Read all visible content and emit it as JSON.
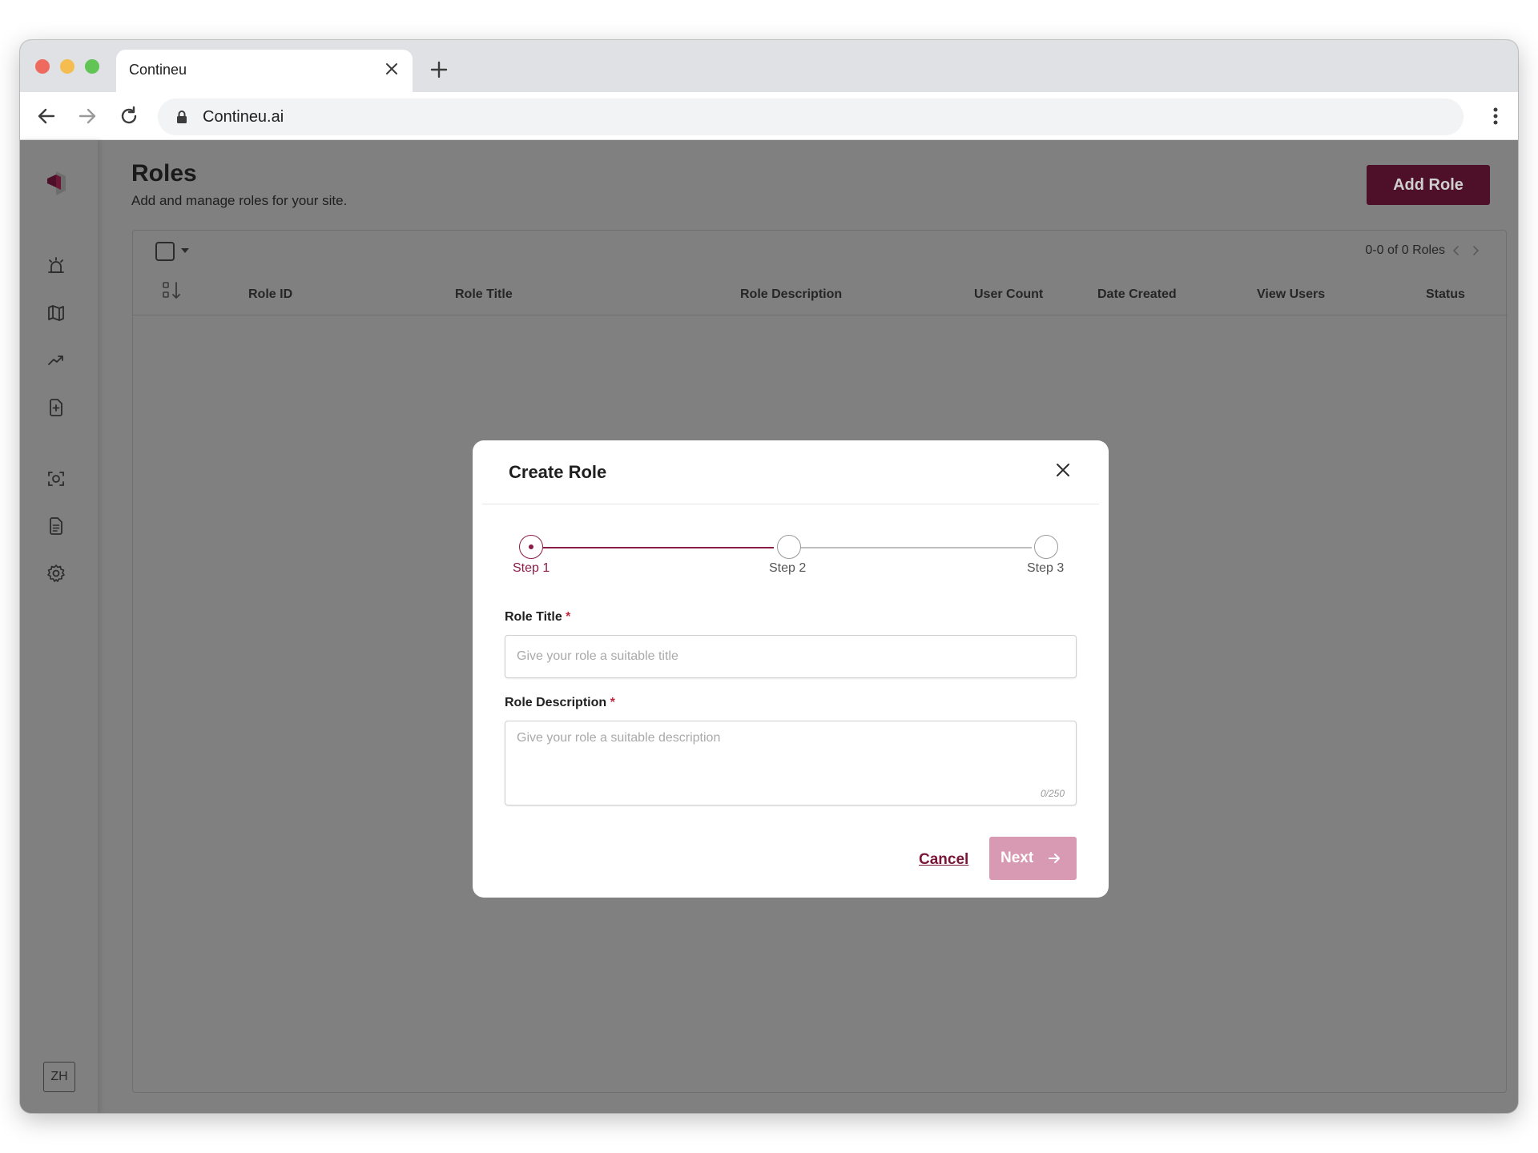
{
  "browser": {
    "tab_title": "Contineu",
    "url": "Contineu.ai",
    "icons": [
      "close-icon",
      "plus-icon",
      "back-arrow-icon",
      "forward-arrow-icon",
      "reload-icon",
      "lock-icon",
      "more-vert-icon"
    ]
  },
  "sidebar": {
    "icons": [
      "logo-icon",
      "alarm-icon",
      "map-icon",
      "trending-up-icon",
      "add-document-icon",
      "face-scan-icon",
      "document-icon",
      "gear-icon"
    ],
    "avatar_initials": "ZH"
  },
  "page": {
    "title": "Roles",
    "subtitle": "Add and manage roles for your site.",
    "add_button_label": "Add Role"
  },
  "table": {
    "pagination_text": "0-0 of 0 Roles",
    "columns": [
      "Role ID",
      "Role Title",
      "Role Description",
      "User Count",
      "Date Created",
      "View Users",
      "Status"
    ],
    "rows": []
  },
  "modal": {
    "title": "Create Role",
    "steps": [
      "Step 1",
      "Step 2",
      "Step 3"
    ],
    "active_step": 1,
    "role_title_label": "Role Title",
    "role_title_placeholder": "Give your role a suitable title",
    "role_title_value": "",
    "role_description_label": "Role Description",
    "role_description_placeholder": "Give your role a suitable description",
    "role_description_value": "",
    "required_marker": "*",
    "char_counter": "0/250",
    "cancel_label": "Cancel",
    "next_label": "Next"
  },
  "colors": {
    "brand": "#4d1028",
    "accent": "#8a1c48",
    "next_disabled": "#d89ab2",
    "overlay": "#808080"
  }
}
